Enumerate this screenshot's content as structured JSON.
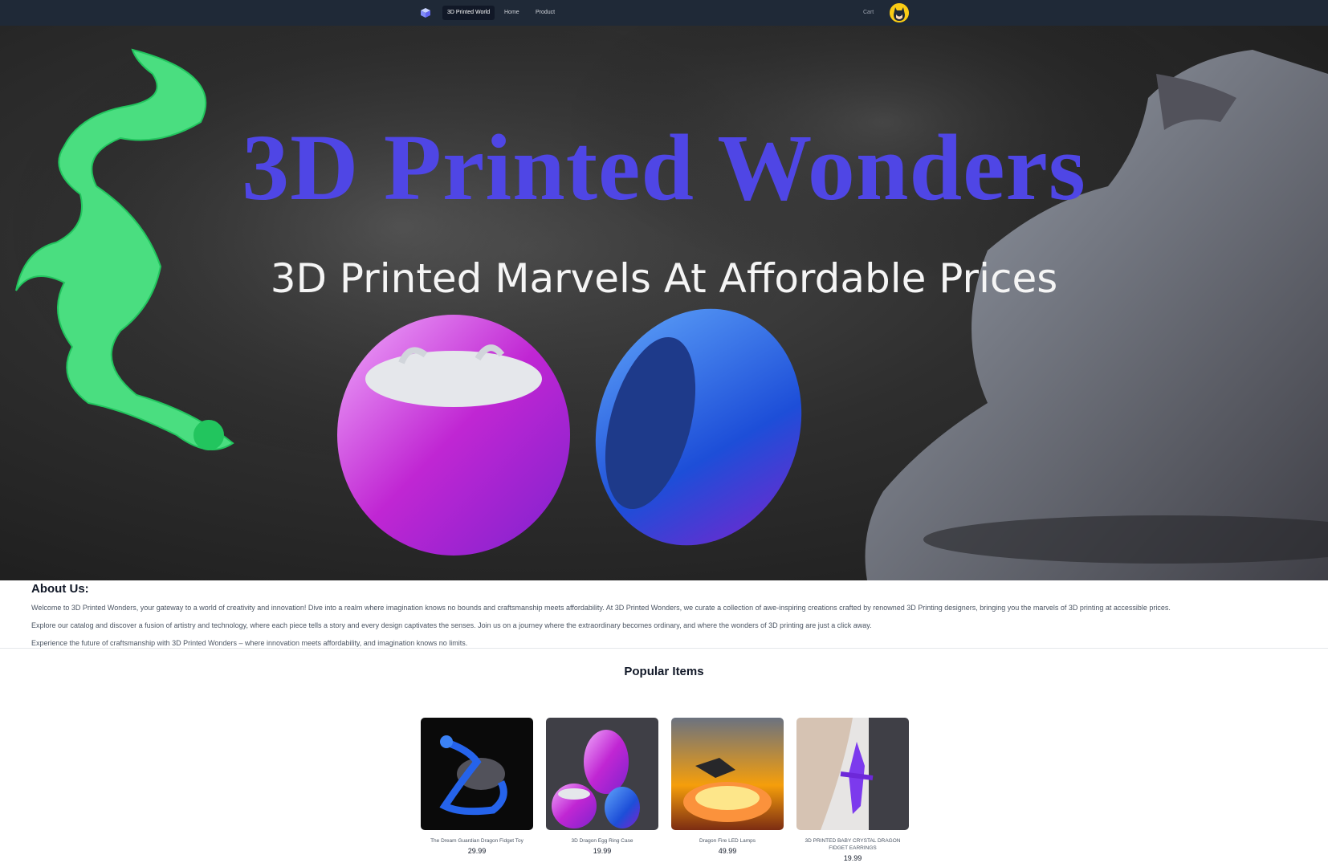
{
  "nav": {
    "logo_icon": "cube-logo-icon",
    "brand": "3D Printed World",
    "links": [
      {
        "label": "Home"
      },
      {
        "label": "Product"
      }
    ],
    "cart": "Cart",
    "avatar_icon": "user-avatar-icon"
  },
  "hero": {
    "title": "3D Printed Wonders",
    "subtitle": "3D Printed Marvels At Affordable Prices"
  },
  "about": {
    "title": "About Us:",
    "paragraphs": [
      "Welcome to 3D Printed Wonders, your gateway to a world of creativity and innovation! Dive into a realm where imagination knows no bounds and craftsmanship meets affordability. At 3D Printed Wonders, we curate a collection of awe-inspiring creations crafted by renowned 3D Printing designers, bringing you the marvels of 3D printing at accessible prices.",
      "Explore our catalog and discover a fusion of artistry and technology, where each piece tells a story and every design captivates the senses. Join us on a journey where the extraordinary becomes ordinary, and where the wonders of 3D printing are just a click away.",
      "Experience the future of craftsmanship with 3D Printed Wonders – where innovation meets affordability, and imagination knows no limits."
    ]
  },
  "popular": {
    "title": "Popular Items",
    "items": [
      {
        "name": "The Dream Guardian Dragon Fidget Toy",
        "price": "29.99"
      },
      {
        "name": "3D Dragon Egg Ring Case",
        "price": "19.99"
      },
      {
        "name": "Dragon Fire LED Lamps",
        "price": "49.99"
      },
      {
        "name": "3D PRINTED BABY CRYSTAL DRAGON FIDGET EARRINGS",
        "price": "19.99"
      }
    ]
  },
  "colors": {
    "navbar": "#1f2937",
    "hero_title": "#4f46e5",
    "active_nav": "#111827"
  }
}
